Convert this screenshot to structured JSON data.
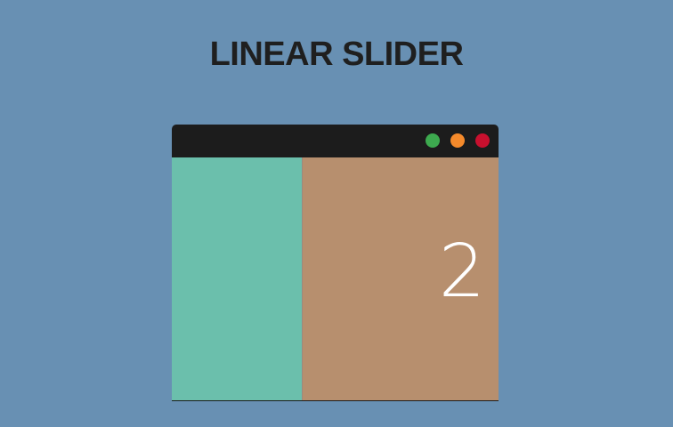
{
  "title": "LINEAR SLIDER",
  "window": {
    "dots": [
      {
        "name": "green",
        "color": "#3daa4f"
      },
      {
        "name": "orange",
        "color": "#f58a2b"
      },
      {
        "name": "red",
        "color": "#c8102e"
      }
    ]
  },
  "slides": [
    {
      "color": "#6bbfac",
      "label": ""
    },
    {
      "color": "#b78f6e",
      "label": "2"
    }
  ]
}
